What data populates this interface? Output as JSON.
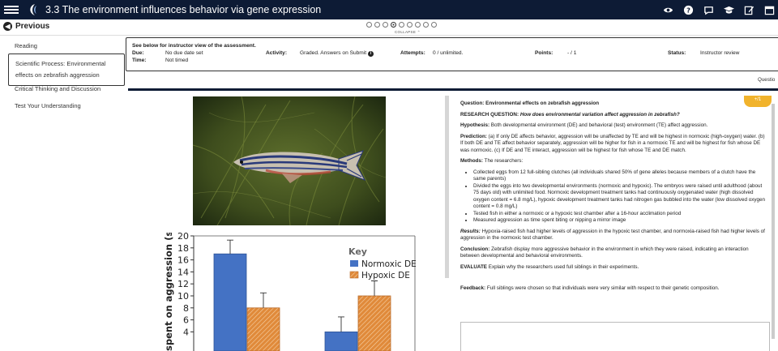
{
  "header": {
    "title": "3.3 The environment influences behavior via gene expression",
    "icons": [
      "eye-icon",
      "help-icon",
      "chat-icon",
      "graduation-cap-icon",
      "edit-icon",
      "calendar-icon"
    ]
  },
  "nav": {
    "previous_label": "Previous",
    "collapse_label": "COLLAPSE",
    "page_count": 9,
    "active_page_index": 3
  },
  "sidebar": {
    "items": [
      {
        "label": "Reading"
      },
      {
        "label": "Scientific Process: Environmental effects on zebrafish aggression"
      },
      {
        "label": "Critical Thinking and Discussion"
      },
      {
        "label": "Test Your Understanding"
      }
    ]
  },
  "assessment": {
    "header": "See below for instructor view of the assessment.",
    "due_label": "Due:",
    "due_value": "No due date set",
    "time_label": "Time:",
    "time_value": "Not timed",
    "activity_label": "Activity:",
    "activity_value": "Graded. Answers on Submit",
    "attempts_label": "Attempts:",
    "attempts_value": "0 / unlimited.",
    "points_label": "Points:",
    "points_value": "- / 1",
    "status_label": "Status:",
    "status_value": "Instructor review",
    "question_tab": "Questio"
  },
  "chart_data": {
    "type": "bar",
    "ylabel": "spent on aggression (s)",
    "ylim": [
      0,
      20
    ],
    "yticks": [
      4,
      6,
      8,
      10,
      12,
      14,
      16,
      18,
      20
    ],
    "legend_title": "Key",
    "legend_position": "top-right",
    "categories": [
      "",
      ""
    ],
    "series": [
      {
        "name": "Normoxic DE",
        "color": "#4472c4",
        "values": [
          17,
          4
        ],
        "errors": [
          2.3,
          2.5
        ]
      },
      {
        "name": "Hypoxic DE",
        "color": "#e08a3a",
        "values": [
          8,
          10
        ],
        "errors": [
          2.5,
          2.5
        ]
      }
    ]
  },
  "question": {
    "title": "Question: Environmental effects on zebrafish aggression",
    "research_label": "RESEARCH QUESTION:",
    "research_text": "How does environmental variation affect aggression in zebrafish?",
    "hypothesis_label": "Hypothesis:",
    "hypothesis_text": "Both developmental environment (DE) and behavioral (test) environment (TE) affect aggression.",
    "prediction_label": "Prediction:",
    "prediction_text": "(a) If only DE affects behavior, aggression will be unaffected by TE and will be highest in normoxic (high-oxygen) water. (b) If both DE and TE affect behavior separately, aggression will be higher for fish in a normoxic TE and will be highest for fish whose DE was normoxic. (c) If DE and TE interact, aggression will be highest for fish whose TE and DE match.",
    "methods_label": "Methods:",
    "methods_intro": "The researchers:",
    "methods": [
      "Collected eggs from 12 full-sibling clutches (all individuals shared 50% of gene alleles because members of a clutch have the same parents)",
      "Divided the eggs into two developmental environments (normoxic and hypoxic). The embryos were raised until adulthood (about 75 days old) with unlimited food. Normoxic development treatment tanks had continuously oxygenated water (high dissolved oxygen content = 6.8 mg/L), hypoxic development treatment tanks had nitrogen gas bubbled into the water (low dissolved oxygen content = 0.8 mg/L)",
      "Tested fish in either a normoxic or a hypoxic test chamber after a 16-hour acclimation period",
      "Measured aggression as time spent biting or nipping a mirror image"
    ],
    "results_label": "Results:",
    "results_text": "Hypoxia-raised fish had higher levels of aggression in the hypoxic test chamber, and normoxia-raised fish had higher levels of aggression in the normoxic test chamber.",
    "conclusion_label": "Conclusion:",
    "conclusion_text": "Zebrafish display more aggressive behavior in the environment in which they were raised, indicating an interaction between developmental and behavioral environments.",
    "evaluate_label": "EVALUATE",
    "evaluate_text": "Explain why the researchers used full siblings in their experiments.",
    "feedback_label": "Feedback:",
    "feedback_text": "Full siblings were chosen so that individuals were very similar with respect to their genetic composition.",
    "badge": "+/1"
  }
}
